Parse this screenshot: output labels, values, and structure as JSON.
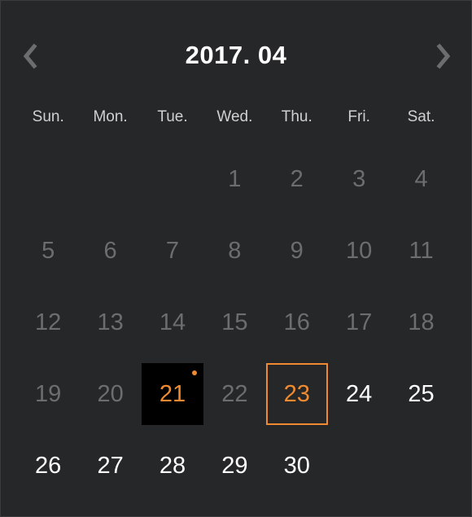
{
  "calendar": {
    "title": "2017. 04",
    "prev_icon": "chevron-left-icon",
    "next_icon": "chevron-right-icon",
    "weekdays": [
      "Sun.",
      "Mon.",
      "Tue.",
      "Wed.",
      "Thu.",
      "Fri.",
      "Sat."
    ],
    "leading_blank_days": 3,
    "days": [
      {
        "label": "1",
        "state": "past"
      },
      {
        "label": "2",
        "state": "past"
      },
      {
        "label": "3",
        "state": "past"
      },
      {
        "label": "4",
        "state": "past"
      },
      {
        "label": "5",
        "state": "past"
      },
      {
        "label": "6",
        "state": "past"
      },
      {
        "label": "7",
        "state": "past"
      },
      {
        "label": "8",
        "state": "past"
      },
      {
        "label": "9",
        "state": "past"
      },
      {
        "label": "10",
        "state": "past"
      },
      {
        "label": "11",
        "state": "past"
      },
      {
        "label": "12",
        "state": "past"
      },
      {
        "label": "13",
        "state": "past"
      },
      {
        "label": "14",
        "state": "past"
      },
      {
        "label": "15",
        "state": "past"
      },
      {
        "label": "16",
        "state": "past"
      },
      {
        "label": "17",
        "state": "past"
      },
      {
        "label": "18",
        "state": "past"
      },
      {
        "label": "19",
        "state": "past"
      },
      {
        "label": "20",
        "state": "past"
      },
      {
        "label": "21",
        "state": "selected",
        "has_event_dot": true
      },
      {
        "label": "22",
        "state": "past"
      },
      {
        "label": "23",
        "state": "today"
      },
      {
        "label": "24",
        "state": "future"
      },
      {
        "label": "25",
        "state": "future"
      },
      {
        "label": "26",
        "state": "future"
      },
      {
        "label": "27",
        "state": "future"
      },
      {
        "label": "28",
        "state": "future"
      },
      {
        "label": "29",
        "state": "future"
      },
      {
        "label": "30",
        "state": "future"
      }
    ]
  },
  "colors": {
    "background": "#252728",
    "accent": "#f08a30",
    "past_day": "#6b6d6f",
    "future_day": "#ffffff",
    "selected_bg": "#000000"
  }
}
